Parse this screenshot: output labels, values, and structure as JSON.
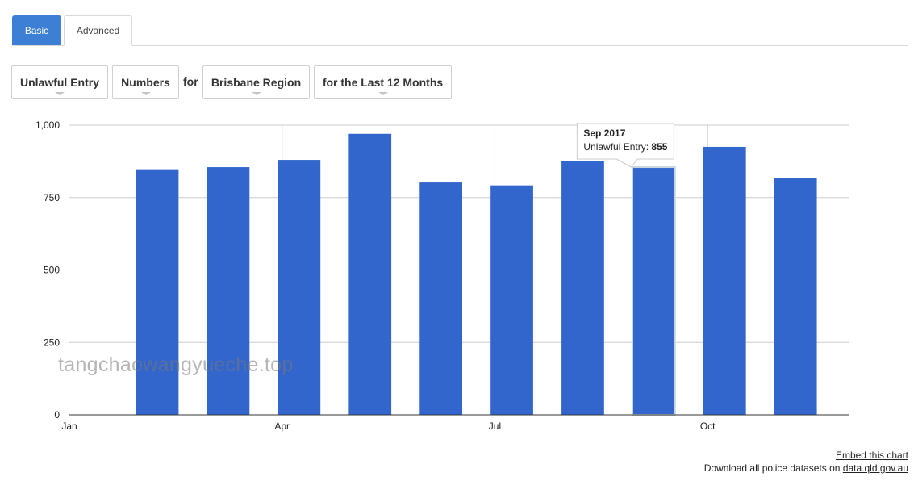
{
  "tabs": [
    {
      "label": "Basic",
      "active": true
    },
    {
      "label": "Advanced",
      "active": false
    }
  ],
  "filters": {
    "offence": "Unlawful Entry",
    "measure": "Numbers",
    "for_word": "for",
    "region": "Brisbane Region",
    "period": "for the Last 12 Months"
  },
  "chart_data": {
    "type": "bar",
    "series": [
      {
        "name": "Unlawful Entry",
        "values": [
          845,
          855,
          880,
          970,
          802,
          792,
          877,
          855,
          925,
          818
        ]
      }
    ],
    "x": [
      "2017-02",
      "2017-03",
      "2017-04",
      "2017-05",
      "2017-06",
      "2017-07",
      "2017-08",
      "2017-09",
      "2017-10",
      "2017-11"
    ],
    "xlim": [
      "2017-01",
      "2017-12"
    ],
    "xticks": [
      {
        "label": "Jan",
        "at": "2017-01"
      },
      {
        "label": "Apr",
        "at": "2017-04"
      },
      {
        "label": "Jul",
        "at": "2017-07"
      },
      {
        "label": "Oct",
        "at": "2017-10"
      }
    ],
    "ylim": [
      0,
      1000
    ],
    "yticks": [
      "0",
      "250",
      "500",
      "750",
      "1,000"
    ],
    "ytick_values": [
      0,
      250,
      500,
      750,
      1000
    ],
    "grid": true,
    "bar_color": "#3366cc",
    "tooltip": {
      "index": 7,
      "title": "Sep 2017",
      "label": "Unlawful Entry:",
      "value": "855"
    }
  },
  "footer": {
    "embed_link": "Embed this chart",
    "download_text": "Download all police datasets on",
    "download_link": "data.qld.gov.au"
  },
  "watermark": "tangchaowangyueche.top"
}
